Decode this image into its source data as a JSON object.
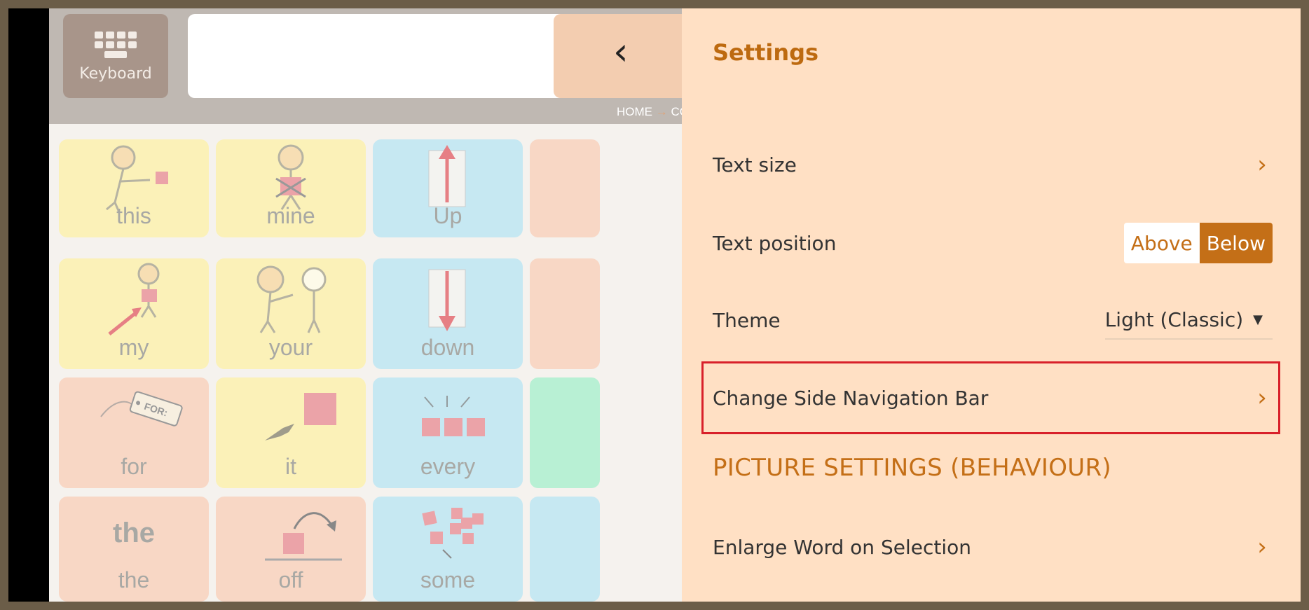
{
  "keyboard": {
    "label": "Keyboard",
    "icon": "keyboard-icon"
  },
  "message_bar": {
    "text": ""
  },
  "back": {
    "symbol": "‹",
    "icon": "back-chevron-icon"
  },
  "breadcrumb": {
    "home": "HOME",
    "separator": "→",
    "current": "CO"
  },
  "grid": {
    "row1": {
      "c1": "this",
      "c2": "mine",
      "c3": "Up"
    },
    "row2": {
      "c1": "my",
      "c2": "your",
      "c3": "down"
    },
    "row3": {
      "c1": "for",
      "c2": "it",
      "c3": "every"
    },
    "row4": {
      "c1_symbol": "the",
      "c1": "the",
      "c2": "off",
      "c3": "some"
    },
    "for_tag_text": "FOR:"
  },
  "settings": {
    "title": "Settings",
    "text_size": {
      "label": "Text size",
      "chevron": "›"
    },
    "text_position": {
      "label": "Text position",
      "option_above": "Above",
      "option_below": "Below",
      "selected": "Below"
    },
    "theme": {
      "label": "Theme",
      "value": "Light (Classic)",
      "caret": "▼"
    },
    "side_nav": {
      "label": "Change Side Navigation Bar",
      "chevron": "›"
    },
    "picture_section": "PICTURE SETTINGS (BEHAVIOUR)",
    "enlarge": {
      "label": "Enlarge Word on Selection",
      "chevron": "›"
    }
  },
  "colors": {
    "accent": "#c46f17",
    "panel_bg": "#ffe0c4",
    "highlight_border": "#d8202a",
    "tile_yellow": "#fbf1b8",
    "tile_blue": "#c6e8f2",
    "tile_pink": "#f8d7c5",
    "tile_green": "#b8f0d4"
  }
}
